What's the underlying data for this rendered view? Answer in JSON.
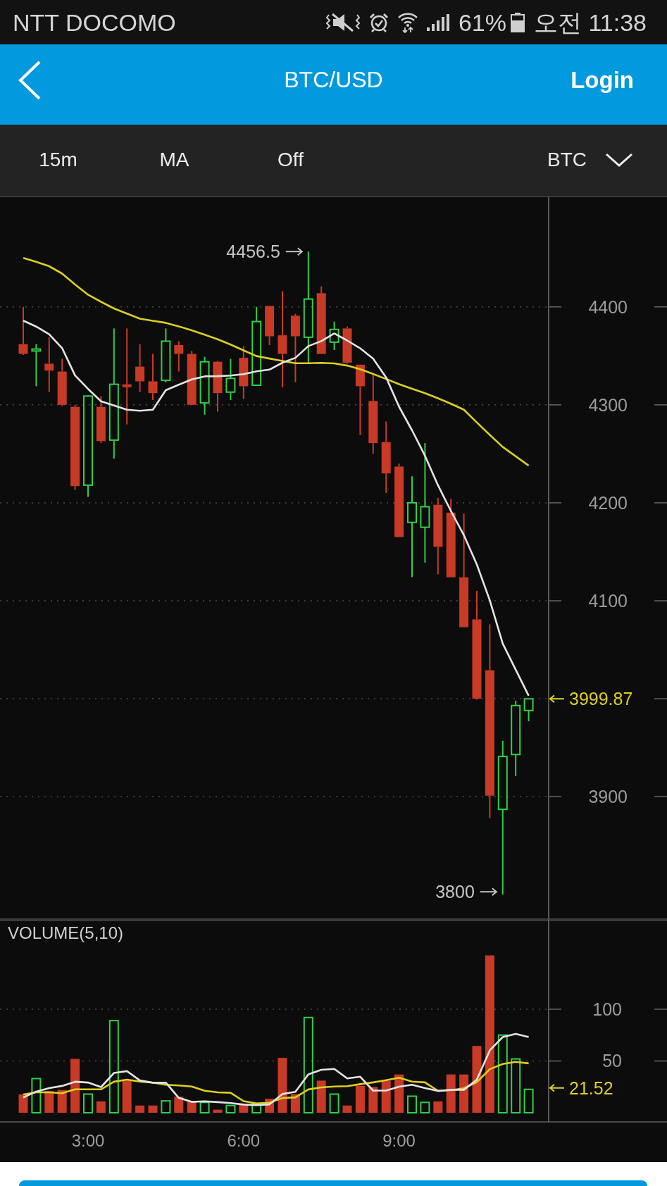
{
  "status_bar": {
    "carrier": "NTT DOCOMO",
    "battery": "61%",
    "time": "오전 11:38"
  },
  "header": {
    "title": "BTC/USD",
    "login": "Login"
  },
  "toolbar": {
    "items": [
      "15m",
      "MA",
      "Off"
    ],
    "currency": "BTC"
  },
  "price_chart": {
    "high_label": "4456.5",
    "low_label": "3800",
    "last_price": "3999.87",
    "chart_data": {
      "type": "candlestick",
      "categories": [
        null,
        null,
        null,
        null,
        null,
        null,
        null,
        null,
        null,
        null,
        null,
        null,
        null,
        null,
        null,
        null,
        null,
        null,
        null,
        null,
        null,
        null,
        null,
        null,
        null,
        null,
        null,
        null,
        null,
        null,
        null,
        null,
        null,
        null,
        null,
        null,
        null,
        null,
        null,
        null
      ],
      "ylim": [
        3775,
        4512
      ],
      "yticks": [
        4400,
        4300,
        4200,
        4100,
        3900
      ],
      "grid": true,
      "ohlc": [
        [
          4362,
          4400,
          4351,
          4352
        ],
        [
          4355,
          4362,
          4319,
          4357
        ],
        [
          4342,
          4369,
          4313,
          4335
        ],
        [
          4334,
          4347,
          4299,
          4300
        ],
        [
          4298,
          4300,
          4213,
          4217
        ],
        [
          4218,
          4310,
          4206,
          4309
        ],
        [
          4298,
          4309,
          4261,
          4263
        ],
        [
          4264,
          4378,
          4245,
          4321
        ],
        [
          4321,
          4378,
          4280,
          4318
        ],
        [
          4339,
          4362,
          4313,
          4324
        ],
        [
          4324,
          4352,
          4305,
          4312
        ],
        [
          4325,
          4378,
          4323,
          4365
        ],
        [
          4361,
          4365,
          4334,
          4352
        ],
        [
          4352,
          4355,
          4300,
          4300
        ],
        [
          4302,
          4349,
          4290,
          4344
        ],
        [
          4344,
          4345,
          4293,
          4312
        ],
        [
          4313,
          4347,
          4305,
          4327
        ],
        [
          4348,
          4360,
          4306,
          4319
        ],
        [
          4320,
          4400,
          4320,
          4385
        ],
        [
          4401,
          4401,
          4361,
          4370
        ],
        [
          4371,
          4416,
          4318,
          4352
        ],
        [
          4391,
          4393,
          4323,
          4370
        ],
        [
          4369,
          4456.5,
          4343,
          4408
        ],
        [
          4414,
          4421,
          4352,
          4352
        ],
        [
          4364,
          4385,
          4356,
          4377
        ],
        [
          4378,
          4380,
          4342,
          4343
        ],
        [
          4341,
          4341,
          4269,
          4319
        ],
        [
          4304,
          4332,
          4250,
          4261
        ],
        [
          4262,
          4283,
          4210,
          4230
        ],
        [
          4237,
          4240,
          4165,
          4165
        ],
        [
          4180,
          4227,
          4124,
          4200
        ],
        [
          4175,
          4261,
          4139,
          4196
        ],
        [
          4198,
          4205,
          4127,
          4155
        ],
        [
          4190,
          4204,
          4124,
          4124
        ],
        [
          4124,
          4189,
          4073,
          4073
        ],
        [
          4081,
          4110,
          3999,
          4000
        ],
        [
          4029,
          4076,
          3878,
          3901
        ],
        [
          3887,
          3957,
          3800,
          3941
        ],
        [
          3943,
          3998,
          3921,
          3993
        ],
        [
          3988,
          4000,
          3977,
          3999.87
        ]
      ],
      "series": [
        {
          "type": "line",
          "color": "#dccf1f",
          "values": [
            4450,
            4446.1,
            4441.5,
            4434,
            4422.9,
            4412.5,
            4405.2,
            4398.4,
            4393.2,
            4388,
            4385.8,
            4383.7,
            4380.1,
            4376,
            4371.6,
            4366.9,
            4361.6,
            4355.6,
            4349.8,
            4347.3,
            4344.8,
            4342.5,
            4342.5,
            4342.9,
            4342.3,
            4340.1,
            4336.4,
            4331.5,
            4326.4,
            4321.1,
            4316.4,
            4312,
            4306.7,
            4301.2,
            4295,
            4282,
            4269.3,
            4257,
            4247.5,
            4238
          ]
        },
        {
          "type": "line",
          "color": "#e4e4e4",
          "values": [
            4386,
            4379.9,
            4372.1,
            4357.9,
            4330,
            4316.3,
            4303.6,
            4299.3,
            4295,
            4293.9,
            4295,
            4315,
            4320.5,
            4326,
            4329.1,
            4329.3,
            4329.9,
            4331.3,
            4334.2,
            4336,
            4343,
            4348,
            4360,
            4365,
            4373,
            4365.7,
            4357.8,
            4347.1,
            4328,
            4298.1,
            4274,
            4248,
            4218,
            4191.7,
            4167,
            4137,
            4100.4,
            4056.3,
            4029.7,
            4003
          ]
        }
      ]
    }
  },
  "volume_chart": {
    "last_volume": "21.52",
    "chart_data": {
      "type": "bar",
      "title": "VOLUME(5,10)",
      "categories": [
        null,
        null,
        null,
        null,
        null,
        "3:00",
        null,
        null,
        null,
        null,
        null,
        null,
        null,
        null,
        null,
        null,
        null,
        "6:00",
        null,
        null,
        null,
        null,
        null,
        null,
        null,
        null,
        null,
        null,
        null,
        "9:00",
        null,
        null,
        null,
        null,
        null,
        null,
        null,
        null,
        null,
        null
      ],
      "ylim": [
        0,
        185.7
      ],
      "yticks": [
        100,
        50
      ],
      "grid": true,
      "stacked": true,
      "series": [
        {
          "color": "#2fcf4a",
          "values": [
            null,
            33,
            null,
            null,
            null,
            18,
            null,
            89,
            null,
            null,
            null,
            11.5,
            null,
            null,
            10,
            null,
            7,
            null,
            9,
            null,
            null,
            null,
            92,
            null,
            18,
            null,
            null,
            null,
            null,
            null,
            16,
            10,
            null,
            null,
            null,
            null,
            null,
            75,
            52,
            22.6
          ]
        },
        {
          "color": "#c83a26",
          "values": [
            17.7,
            null,
            21,
            22,
            52,
            null,
            11,
            null,
            31,
            7,
            7,
            null,
            15.6,
            11.5,
            null,
            3,
            null,
            8,
            null,
            13.5,
            53,
            18,
            null,
            31,
            null,
            7,
            26,
            25,
            31,
            37,
            null,
            null,
            11,
            37,
            37,
            64.5,
            152,
            null,
            null,
            null
          ]
        },
        {
          "type": "line",
          "color": "#dccf1f",
          "values": [
            17.7,
            19.7,
            19.7,
            18.9,
            22.6,
            22.6,
            22.6,
            30,
            32,
            30.2,
            29.1,
            27,
            26.4,
            25.4,
            21.2,
            19.7,
            19.3,
            11.2,
            9,
            9.6,
            14.2,
            14.9,
            22.5,
            24.5,
            25.3,
            25.7,
            27.6,
            29.3,
            31.5,
            33.8,
            30.1,
            29.3,
            21.2,
            21.8,
            23.7,
            29.5,
            42.1,
            47.1,
            49.2,
            47.7
          ]
        },
        {
          "type": "line",
          "color": "#e4e4e4",
          "values": [
            14.8,
            20.5,
            23.8,
            25.9,
            30,
            29.2,
            24.8,
            38.4,
            40.2,
            31.2,
            29,
            29.1,
            14.4,
            10.5,
            11.1,
            10.3,
            9.4,
            7.9,
            7.4,
            8.1,
            18.1,
            20.3,
            37.1,
            41.5,
            42.4,
            33.2,
            34.8,
            21.4,
            21.4,
            25.2,
            27,
            23.8,
            21,
            22.2,
            22.2,
            31.9,
            60.3,
            73.1,
            76.1,
            73.2
          ]
        }
      ]
    }
  }
}
